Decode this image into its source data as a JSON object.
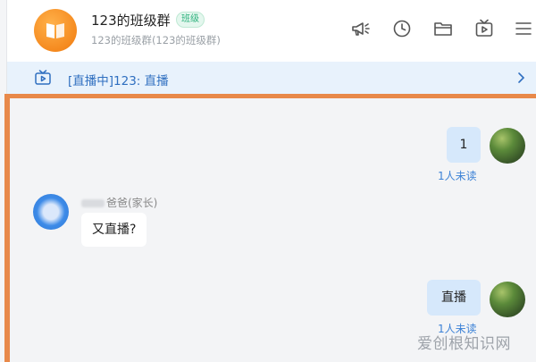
{
  "header": {
    "group_name": "123的班级群",
    "group_tag": "班级",
    "group_subtitle": "123的班级群(123的班级群)",
    "icons": [
      "announcement-icon",
      "history-icon",
      "folder-icon",
      "live-icon",
      "menu-icon"
    ]
  },
  "banner": {
    "text": "[直播中]123: 直播"
  },
  "messages": [
    {
      "from": "self",
      "text": "1",
      "status": "1人未读"
    },
    {
      "from": "other",
      "sender": "爸爸(家长)",
      "text": "又直播?"
    },
    {
      "from": "self",
      "text": "直播",
      "status": "1人未读"
    }
  ],
  "watermark": "爱创根知识网",
  "colors": {
    "accent": "#e8894a",
    "self_bubble": "#d6e8fb",
    "banner_bg": "#e8f2fc",
    "banner_text": "#2f6fc0",
    "unread_text": "#3d82d6"
  }
}
